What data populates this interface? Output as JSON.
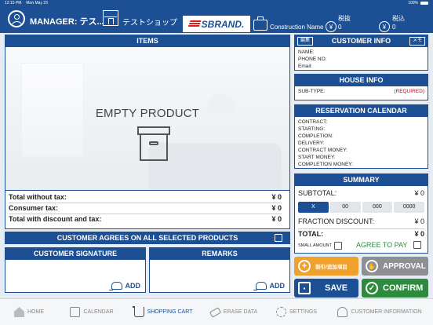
{
  "status_bar": {
    "time": "12:15 PM",
    "date": "Mon May 23",
    "battery": "100%"
  },
  "header": {
    "manager": "MANAGER: テス...",
    "shop": "テストショップ",
    "logo": "SBRAND.",
    "construction_name": "Construction Name",
    "tax_excl": {
      "label": "税抜",
      "currency": "¥",
      "value": "0"
    },
    "tax_incl": {
      "label": "税込",
      "currency": "¥",
      "value": "0"
    }
  },
  "items": {
    "title": "ITEMS",
    "empty": "EMPTY PRODUCT",
    "totals": [
      {
        "label": "Total without tax:",
        "value": "¥ 0"
      },
      {
        "label": "Consumer tax:",
        "value": "¥ 0"
      },
      {
        "label": "Total with discount and tax:",
        "value": "¥ 0"
      }
    ]
  },
  "agree_all": {
    "label": "CUSTOMER AGREES ON ALL SELECTED PRODUCTS",
    "checked": false
  },
  "signature": {
    "title": "CUSTOMER SIGNATURE",
    "add": "ADD"
  },
  "remarks": {
    "title": "REMARKS",
    "add": "ADD"
  },
  "customer_info": {
    "title": "CUSTOMER INFO",
    "edit": "編集",
    "memo": "メモ",
    "fields": [
      {
        "label": "NAME:",
        "value": ""
      },
      {
        "label": "PHONE NO:",
        "value": ""
      },
      {
        "label": "Email:",
        "value": ""
      }
    ]
  },
  "house_info": {
    "title": "HOUSE INFO",
    "subtype_label": "SUB-TYPE:",
    "required": "(REQUIRED)"
  },
  "reservation": {
    "title": "RESERVATION CALENDAR",
    "fields": [
      "CONTRACT:",
      "STARTING:",
      "COMPLETION:",
      "DELIVERY:",
      "CONTRACT MONEY:",
      "START MONEY:",
      "COMPLETION MONEY:"
    ]
  },
  "summary": {
    "title": "SUMMARY",
    "subtotal_label": "SUBTOTAL:",
    "subtotal": "¥ 0",
    "rounding": [
      "X",
      "00",
      "000",
      "0000"
    ],
    "rounding_selected": "X",
    "fraction_label": "FRACTION DISCOUNT:",
    "fraction": "¥ 0",
    "total_label": "TOTAL:",
    "total": "¥ 0",
    "small_amount": "SMALL AMOUNT",
    "agree_to_pay": "AGREE TO PAY"
  },
  "actions": {
    "discount": "割引/追加項目",
    "approval": "APPROVAL",
    "save": "SAVE",
    "confirm": "CONFIRM"
  },
  "nav": [
    {
      "label": "HOME",
      "icon": "home-icon"
    },
    {
      "label": "CALENDAR",
      "icon": "calendar-icon"
    },
    {
      "label": "SHOPPING CART",
      "icon": "cart-icon"
    },
    {
      "label": "ERASE DATA",
      "icon": "eraser-icon"
    },
    {
      "label": "SETTINGS",
      "icon": "gear-icon"
    },
    {
      "label": "CUSTOMER INFORMATION",
      "icon": "person-icon"
    }
  ],
  "nav_active": "SHOPPING CART",
  "colors": {
    "primary": "#1c4f93",
    "orange": "#f0a02c",
    "approval": "#8d8f92",
    "save": "#1c4f93",
    "confirm": "#2e8b3d",
    "required": "#cc0000"
  }
}
